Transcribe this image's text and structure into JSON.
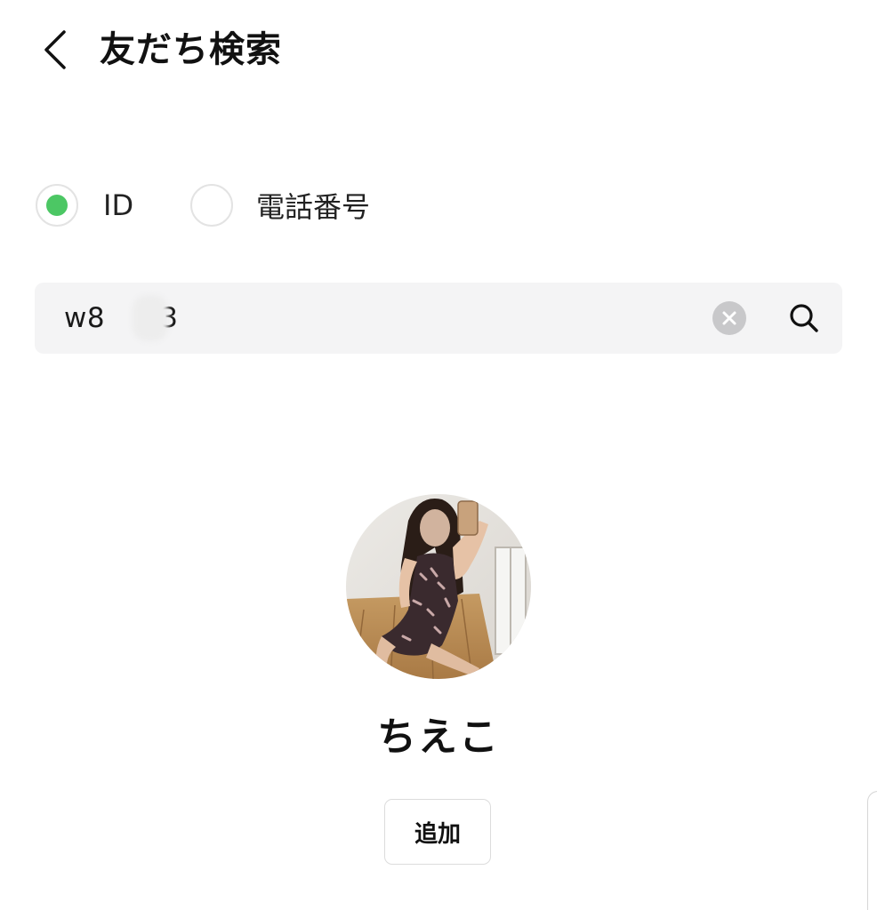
{
  "header": {
    "back_icon": "chevron-left-icon",
    "title": "友だち検索"
  },
  "search_type": {
    "options": [
      {
        "label": "ID",
        "selected": true
      },
      {
        "label": "電話番号",
        "selected": false
      }
    ],
    "selected_color": "#4cc764"
  },
  "search": {
    "value_prefix": "w8",
    "value_suffix": "33",
    "clear_icon": "clear-circle-icon",
    "search_icon": "search-icon"
  },
  "result": {
    "name": "ちえこ",
    "add_label": "追加"
  }
}
